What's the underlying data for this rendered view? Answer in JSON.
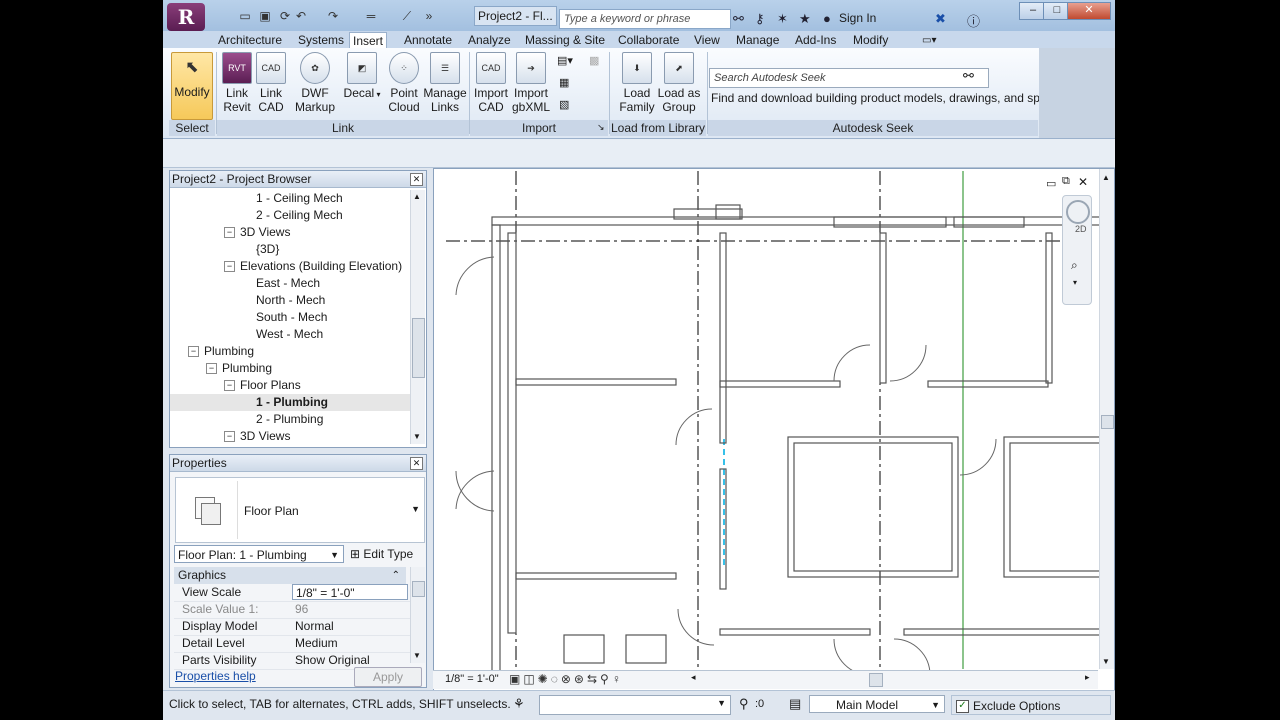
{
  "title_bar": {
    "app_letter": "R",
    "doc_title": "Project2 - Fl...",
    "search_placeholder": "Type a keyword or phrase",
    "sign_in": "Sign In"
  },
  "tabs": [
    "Architecture",
    "Systems",
    "Insert",
    "Annotate",
    "Analyze",
    "Massing & Site",
    "Collaborate",
    "View",
    "Manage",
    "Add-Ins",
    "Modify"
  ],
  "active_tab": "Insert",
  "ribbon": {
    "modify": [
      "Modify",
      ""
    ],
    "link_revit": [
      "Link",
      "Revit"
    ],
    "link_cad": [
      "Link",
      "CAD"
    ],
    "dwf_markup": [
      "DWF",
      "Markup"
    ],
    "decal": [
      "Decal",
      ""
    ],
    "point_cloud": [
      "Point",
      "Cloud"
    ],
    "manage_links": [
      "Manage",
      "Links"
    ],
    "import_cad": [
      "Import",
      "CAD"
    ],
    "import_gbxml": [
      "Import",
      "gbXML"
    ],
    "load_family": [
      "Load",
      "Family"
    ],
    "load_as_group": [
      "Load as",
      "Group"
    ],
    "seek_placeholder": "Search Autodesk Seek",
    "seek_description": "Find and download building product models, drawings, and specs",
    "panels": {
      "select": "Select",
      "link": "Link",
      "import": "Import",
      "load_from_library": "Load from Library",
      "autodesk_seek": "Autodesk Seek"
    }
  },
  "project_browser": {
    "title": "Project2 - Project Browser",
    "items": [
      {
        "label": "1 - Ceiling Mech",
        "level": 4,
        "exp": ""
      },
      {
        "label": "2 - Ceiling Mech",
        "level": 4,
        "exp": ""
      },
      {
        "label": "3D Views",
        "level": 3,
        "exp": "−"
      },
      {
        "label": "{3D}",
        "level": 4,
        "exp": ""
      },
      {
        "label": "Elevations (Building Elevation)",
        "level": 3,
        "exp": "−"
      },
      {
        "label": "East - Mech",
        "level": 4,
        "exp": ""
      },
      {
        "label": "North - Mech",
        "level": 4,
        "exp": ""
      },
      {
        "label": "South - Mech",
        "level": 4,
        "exp": ""
      },
      {
        "label": "West - Mech",
        "level": 4,
        "exp": ""
      },
      {
        "label": "Plumbing",
        "level": 1,
        "exp": "−"
      },
      {
        "label": "Plumbing",
        "level": 2,
        "exp": "−"
      },
      {
        "label": "Floor Plans",
        "level": 3,
        "exp": "−"
      },
      {
        "label": "1 - Plumbing",
        "level": 4,
        "exp": "",
        "selected": true
      },
      {
        "label": "2 - Plumbing",
        "level": 4,
        "exp": ""
      },
      {
        "label": "3D Views",
        "level": 3,
        "exp": "−"
      }
    ]
  },
  "properties": {
    "title": "Properties",
    "type_name": "Floor Plan",
    "type_selector": "Floor Plan: 1 - Plumbing",
    "edit_type": "Edit Type",
    "group": "Graphics",
    "rows": [
      {
        "key": "View Scale",
        "value": "1/8\" = 1'-0\"",
        "editable": true
      },
      {
        "key": "Scale Value    1:",
        "value": "96",
        "disabled": true
      },
      {
        "key": "Display Model",
        "value": "Normal"
      },
      {
        "key": "Detail Level",
        "value": "Medium"
      },
      {
        "key": "Parts Visibility",
        "value": "Show Original"
      }
    ],
    "help_link": "Properties help",
    "apply": "Apply"
  },
  "view": {
    "scale_label": "1/8\" = 1'-0\"",
    "cube_label": "2D"
  },
  "status_bar": {
    "message": "Click to select, TAB for alternates, CTRL adds, SHIFT unselects.",
    "filter_count": ":0",
    "model": "Main Model",
    "exclude_options": "Exclude Options"
  }
}
